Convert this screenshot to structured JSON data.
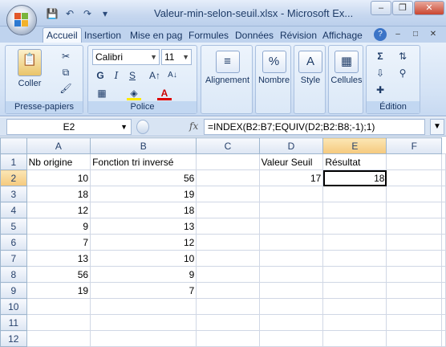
{
  "window": {
    "title": "Valeur-min-selon-seuil.xlsx - Microsoft Ex...",
    "minimize": "–",
    "restore": "❐",
    "close": "✕"
  },
  "qat": {
    "save_icon": "💾",
    "undo_icon": "↶",
    "redo_icon": "↷",
    "more_icon": "▾"
  },
  "tabs": [
    "Accueil",
    "Insertion",
    "Mise en pag",
    "Formules",
    "Données",
    "Révision",
    "Affichage"
  ],
  "ribbon": {
    "clipboard": {
      "label": "Presse-papiers",
      "paste": "Coller"
    },
    "font": {
      "label": "Police",
      "font_name": "Calibri",
      "font_size": "11"
    },
    "alignment": {
      "label": "Alignement"
    },
    "number": {
      "label": "Nombre"
    },
    "style": {
      "label": "Style"
    },
    "cells": {
      "label": "Cellules"
    },
    "editing": {
      "label": "Édition"
    }
  },
  "formula_bar": {
    "name_box": "E2",
    "fx": "fx",
    "formula": "=INDEX(B2:B7;EQUIV(D2;B2:B8;-1);1)"
  },
  "sheet": {
    "columns": [
      "A",
      "B",
      "C",
      "D",
      "E",
      "F"
    ],
    "rows": [
      [
        "Nb origine",
        "Fonction tri inversé",
        "",
        "Valeur Seuil",
        "Résultat",
        ""
      ],
      [
        "10",
        "56",
        "",
        "17",
        "18",
        ""
      ],
      [
        "18",
        "19",
        "",
        "",
        "",
        ""
      ],
      [
        "12",
        "18",
        "",
        "",
        "",
        ""
      ],
      [
        "9",
        "13",
        "",
        "",
        "",
        ""
      ],
      [
        "7",
        "12",
        "",
        "",
        "",
        ""
      ],
      [
        "13",
        "10",
        "",
        "",
        "",
        ""
      ],
      [
        "56",
        "9",
        "",
        "",
        "",
        ""
      ],
      [
        "19",
        "7",
        "",
        "",
        "",
        ""
      ],
      [
        "",
        "",
        "",
        "",
        "",
        ""
      ],
      [
        "",
        "",
        "",
        "",
        "",
        ""
      ],
      [
        "",
        "",
        "",
        "",
        "",
        ""
      ]
    ],
    "selected_cell": "E2",
    "selection_color": "#f5c97d"
  }
}
